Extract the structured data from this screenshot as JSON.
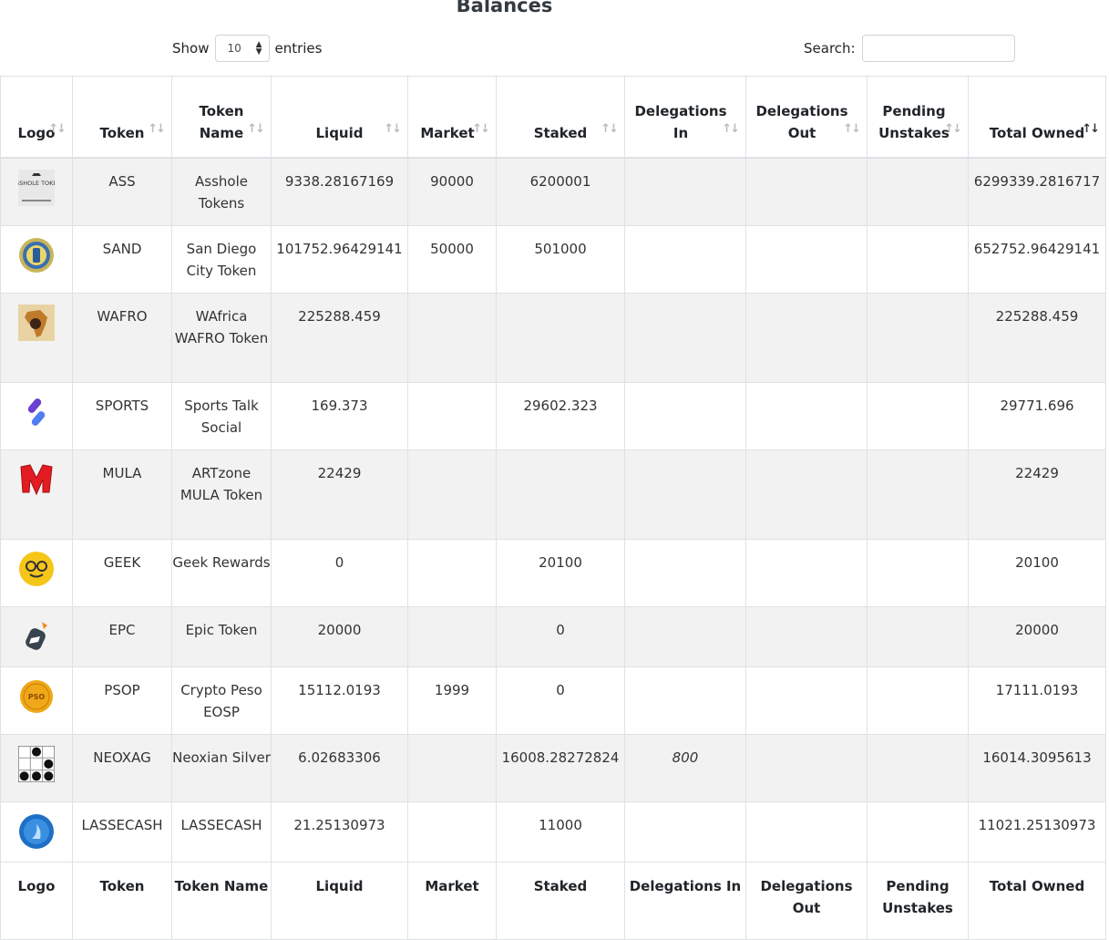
{
  "title": "Balances",
  "length": {
    "show": "Show",
    "value": "10",
    "entries": "entries"
  },
  "search": {
    "label": "Search:",
    "value": ""
  },
  "columns": [
    "Logo",
    "Token",
    "Token Name",
    "Liquid",
    "Market",
    "Staked",
    "Delegations In",
    "Delegations Out",
    "Pending Unstakes",
    "Total Owned"
  ],
  "rows": [
    {
      "logo": "ass-token-logo",
      "token": "ASS",
      "name": "Asshole Tokens",
      "liquid": "9338.28167169",
      "market": "90000",
      "staked": "6200001",
      "deleg_in": "",
      "deleg_out": "",
      "pending": "",
      "total": "6299339.2816717"
    },
    {
      "logo": "sand-token-logo",
      "token": "SAND",
      "name": "San Diego City Token",
      "liquid": "101752.96429141",
      "market": "50000",
      "staked": "501000",
      "deleg_in": "",
      "deleg_out": "",
      "pending": "",
      "total": "652752.96429141"
    },
    {
      "logo": "wafro-token-logo",
      "token": "WAFRO",
      "name": "WAfrica WAFRO Token",
      "liquid": "225288.459",
      "market": "",
      "staked": "",
      "deleg_in": "",
      "deleg_out": "",
      "pending": "",
      "total": "225288.459"
    },
    {
      "logo": "sports-token-logo",
      "token": "SPORTS",
      "name": "Sports Talk Social",
      "liquid": "169.373",
      "market": "",
      "staked": "29602.323",
      "deleg_in": "",
      "deleg_out": "",
      "pending": "",
      "total": "29771.696"
    },
    {
      "logo": "mula-token-logo",
      "token": "MULA",
      "name": "ARTzone MULA Token",
      "liquid": "22429",
      "market": "",
      "staked": "",
      "deleg_in": "",
      "deleg_out": "",
      "pending": "",
      "total": "22429"
    },
    {
      "logo": "geek-token-logo",
      "token": "GEEK",
      "name": "Geek Rewards",
      "liquid": "0",
      "market": "",
      "staked": "20100",
      "deleg_in": "",
      "deleg_out": "",
      "pending": "",
      "total": "20100"
    },
    {
      "logo": "epc-token-logo",
      "token": "EPC",
      "name": "Epic Token",
      "liquid": "20000",
      "market": "",
      "staked": "0",
      "deleg_in": "",
      "deleg_out": "",
      "pending": "",
      "total": "20000"
    },
    {
      "logo": "psop-token-logo",
      "token": "PSOP",
      "name": "Crypto Peso EOSP",
      "liquid": "15112.0193",
      "market": "1999",
      "staked": "0",
      "deleg_in": "",
      "deleg_out": "",
      "pending": "",
      "total": "17111.0193"
    },
    {
      "logo": "neoxag-token-logo",
      "token": "NEOXAG",
      "name": "Neoxian Silver",
      "liquid": "6.02683306",
      "market": "",
      "staked": "16008.28272824",
      "deleg_in": "800",
      "deleg_out": "",
      "pending": "",
      "total": "16014.3095613"
    },
    {
      "logo": "lassecash-token-logo",
      "token": "LASSECASH",
      "name": "LASSECASH",
      "liquid": "21.25130973",
      "market": "",
      "staked": "11000",
      "deleg_in": "",
      "deleg_out": "",
      "pending": "",
      "total": "11021.25130973"
    }
  ],
  "logo_text": {
    "ass": "ASSHOLE TOKEN",
    "psop": "PSO"
  },
  "colors": {
    "stripe": "#f2f2f2",
    "border": "#dee2e6"
  }
}
